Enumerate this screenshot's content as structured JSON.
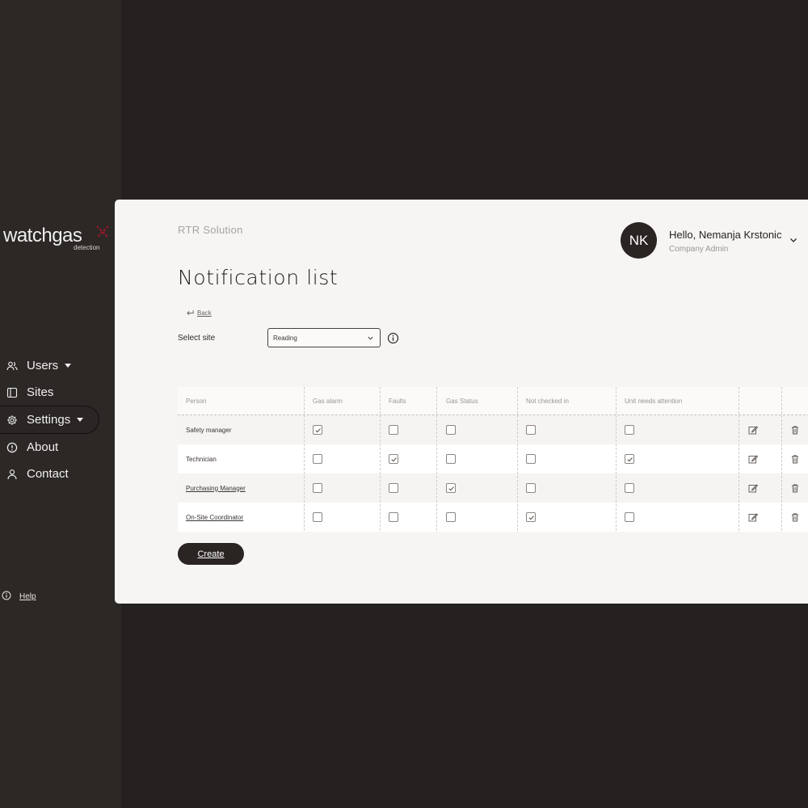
{
  "brand": {
    "name": "watchgas",
    "tagline": "detection",
    "accent_color": "#8c1b2b"
  },
  "sidebar": {
    "items": [
      {
        "label": "Users",
        "icon": "users-icon",
        "has_caret": true,
        "active": false
      },
      {
        "label": "Sites",
        "icon": "sites-icon",
        "has_caret": false,
        "active": false
      },
      {
        "label": "Settings",
        "icon": "gear-icon",
        "has_caret": true,
        "active": true
      },
      {
        "label": "About",
        "icon": "info-circle-icon",
        "has_caret": false,
        "active": false
      },
      {
        "label": "Contact",
        "icon": "person-icon",
        "has_caret": false,
        "active": false
      }
    ],
    "help_label": "Help"
  },
  "header": {
    "organization": "RTR Solution",
    "page_title": "Notification list",
    "user": {
      "initials": "NK",
      "greeting": "Hello, Nemanja Krstonic",
      "role": "Company Admin"
    }
  },
  "filters": {
    "back_label": "Back",
    "site_label": "Select site",
    "site_value": "Reading"
  },
  "table": {
    "columns": [
      "Person",
      "Gas alarm",
      "Faults",
      "Gas Status",
      "Not checked in",
      "Unit needs attention"
    ],
    "rows": [
      {
        "person": "Safety manager",
        "checks": [
          true,
          false,
          false,
          false,
          false
        ]
      },
      {
        "person": "Technician",
        "checks": [
          false,
          true,
          false,
          false,
          true
        ]
      },
      {
        "person": "Purchasing Manager",
        "checks": [
          false,
          false,
          true,
          false,
          false
        ]
      },
      {
        "person": "On-Site Coordinator",
        "checks": [
          false,
          false,
          false,
          true,
          false
        ]
      }
    ]
  },
  "actions": {
    "create_label": "Create"
  }
}
